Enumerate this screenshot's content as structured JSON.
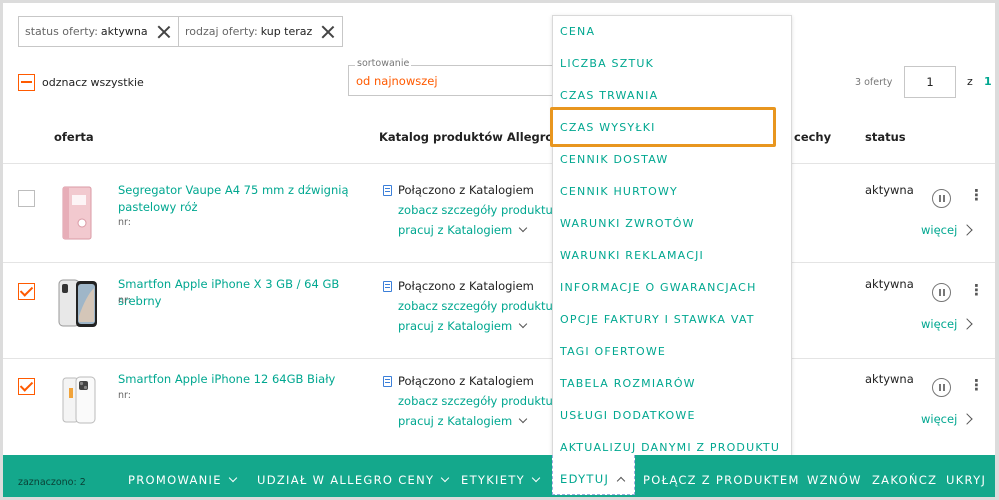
{
  "filters": [
    {
      "label": "status oferty:",
      "value": "aktywna"
    },
    {
      "label": "rodzaj oferty:",
      "value": "kup teraz"
    }
  ],
  "deselect_all": "odznacz wszystkie",
  "sort": {
    "caption": "sortowanie",
    "value": "od najnowszej"
  },
  "pagination": {
    "count": "3 oferty",
    "page": "1",
    "of": "z",
    "total": "1"
  },
  "columns": {
    "offer": "oferta",
    "catalog": "Katalog produktów Allegro",
    "features": "cechy",
    "status": "status"
  },
  "rows": [
    {
      "checked": false,
      "title": "Segregator Vaupe A4 75 mm z dźwignią pastelowy róż",
      "nr": "nr:",
      "linked": "Połączono z Katalogiem",
      "details": "zobacz szczegóły produktu",
      "work": "pracuj z Katalogiem",
      "status": "aktywna",
      "more": "więcej"
    },
    {
      "checked": true,
      "title": "Smartfon Apple iPhone X 3 GB / 64 GB srebrny",
      "nr": "nr:",
      "linked": "Połączono z Katalogiem",
      "details": "zobacz szczegóły produktu",
      "work": "pracuj z Katalogiem",
      "status": "aktywna",
      "more": "więcej"
    },
    {
      "checked": true,
      "title": "Smartfon Apple iPhone 12 64GB Biały",
      "nr": "nr:",
      "linked": "Połączono z Katalogiem",
      "details": "zobacz szczegóły produktu",
      "work": "pracuj z Katalogiem",
      "status": "aktywna",
      "more": "więcej"
    }
  ],
  "menu": {
    "items": [
      "CENA",
      "LICZBA SZTUK",
      "CZAS TRWANIA",
      "CZAS WYSYŁKI",
      "CENNIK DOSTAW",
      "CENNIK HURTOWY",
      "WARUNKI ZWROTÓW",
      "WARUNKI REKLAMACJI",
      "INFORMACJE O GWARANCJACH",
      "OPCJE FAKTURY I STAWKA VAT",
      "TAGI OFERTOWE",
      "TABELA ROZMIARÓW",
      "USŁUGI DODATKOWE",
      "AKTUALIZUJ DANYMI Z PRODUKTU"
    ],
    "highlighted": "CZAS WYSYŁKI"
  },
  "action_bar": {
    "selected": "zaznaczono: 2",
    "promote": "PROMOWANIE",
    "price_share": "UDZIAŁ W ALLEGRO CENY",
    "labels": "ETYKIETY",
    "edit": "EDYTUJ",
    "link_product": "POŁĄCZ Z PRODUKTEM",
    "resume": "WZNÓW",
    "end": "ZAKOŃCZ",
    "hide": "UKRYJ"
  },
  "colors": {
    "accent": "#00a790",
    "orange": "#ff5a00",
    "bar": "#14a88c",
    "highlight": "#e8961f"
  }
}
